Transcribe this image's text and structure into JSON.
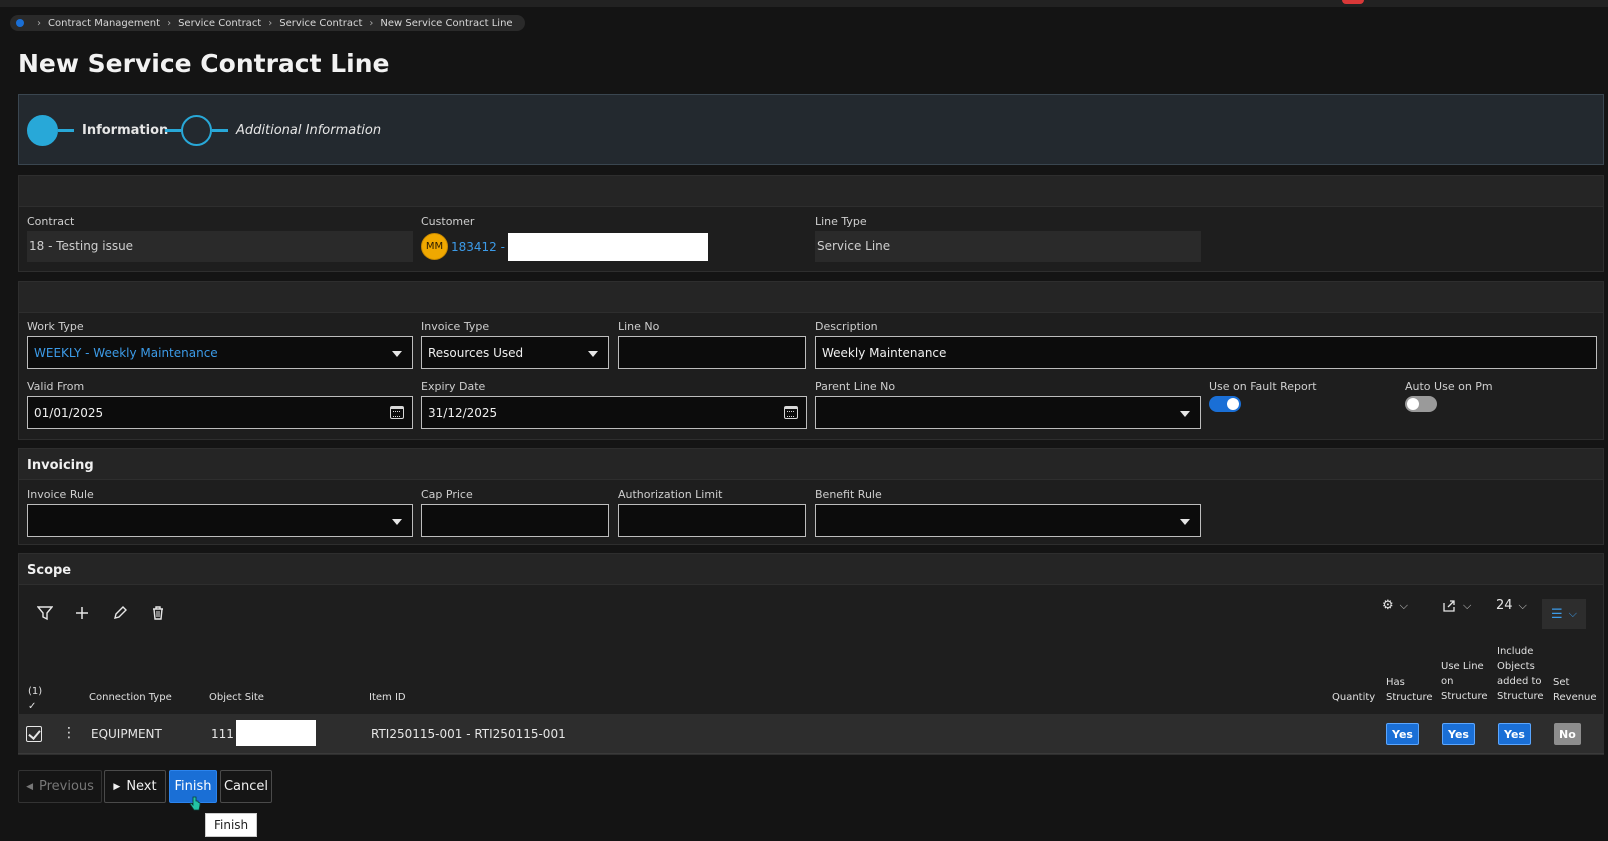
{
  "breadcrumb": [
    "Contract Management",
    "Service Contract",
    "Service Contract",
    "New Service Contract Line"
  ],
  "page_title": "New Service Contract Line",
  "steps": [
    {
      "label": "Information"
    },
    {
      "label": "Additional Information"
    }
  ],
  "contract_section": {
    "contract": {
      "label": "Contract",
      "value": "18 - Testing issue"
    },
    "customer": {
      "label": "Customer",
      "avatar": "MM",
      "value": "183412 -"
    },
    "line_type": {
      "label": "Line Type",
      "value": "Service Line"
    }
  },
  "details": {
    "work_type": {
      "label": "Work Type",
      "value": "WEEKLY - Weekly Maintenance"
    },
    "invoice_type": {
      "label": "Invoice Type",
      "value": "Resources Used"
    },
    "line_no": {
      "label": "Line No",
      "value": ""
    },
    "description": {
      "label": "Description",
      "value": "Weekly Maintenance"
    },
    "valid_from": {
      "label": "Valid From",
      "value": "01/01/2025"
    },
    "expiry_date": {
      "label": "Expiry Date",
      "value": "31/12/2025"
    },
    "parent_line_no": {
      "label": "Parent Line No",
      "value": ""
    },
    "use_on_fault_report": {
      "label": "Use on Fault Report",
      "on": true
    },
    "auto_use_on_pm": {
      "label": "Auto Use on Pm",
      "on": false
    }
  },
  "invoicing": {
    "title": "Invoicing",
    "invoice_rule": {
      "label": "Invoice Rule",
      "value": ""
    },
    "cap_price": {
      "label": "Cap Price",
      "value": ""
    },
    "authorization_limit": {
      "label": "Authorization Limit",
      "value": ""
    },
    "benefit_rule": {
      "label": "Benefit Rule",
      "value": ""
    }
  },
  "scope": {
    "title": "Scope",
    "page_size": "24",
    "selected_count": "(1)",
    "columns": {
      "connection_type": "Connection Type",
      "object_site": "Object Site",
      "item_id": "Item ID",
      "quantity": "Quantity",
      "has_structure": [
        "Has",
        "Structure"
      ],
      "use_line_on_structure": [
        "Use Line",
        "on",
        "Structure"
      ],
      "include_objects": [
        "Include",
        "Objects",
        "added to",
        "Structure"
      ],
      "set_revenue": [
        "Set",
        "Revenue"
      ]
    },
    "rows": [
      {
        "connection_type": "EQUIPMENT",
        "object_site": "111 -",
        "item_id": "RTI250115-001 - RTI250115-001",
        "quantity": "",
        "has_structure": "Yes",
        "use_line_on_structure": "Yes",
        "include_objects": "Yes",
        "set_revenue": "No"
      }
    ]
  },
  "buttons": {
    "previous": "Previous",
    "next": "Next",
    "finish": "Finish",
    "cancel": "Cancel"
  },
  "tooltip": "Finish",
  "icons": [
    "filter-icon",
    "add-icon",
    "edit-icon",
    "delete-icon",
    "settings-icon",
    "export-icon",
    "list-view-icon",
    "calendar-icon",
    "chevron-down-icon"
  ],
  "colors": {
    "accent": "#1a6fd6",
    "step": "#28a8d8",
    "avatar": "#f0a800"
  }
}
